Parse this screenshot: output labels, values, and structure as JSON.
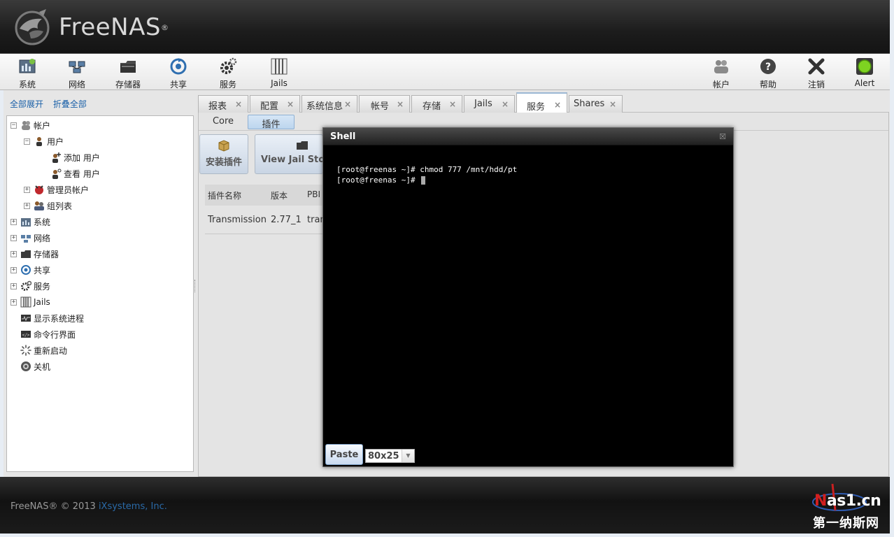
{
  "app": {
    "brand": "FreeNAS",
    "reg": "®"
  },
  "toolbar": {
    "left": [
      {
        "label": "系统",
        "icon": "system-icon"
      },
      {
        "label": "网络",
        "icon": "network-icon"
      },
      {
        "label": "存储器",
        "icon": "storage-icon"
      },
      {
        "label": "共享",
        "icon": "sharing-icon"
      },
      {
        "label": "服务",
        "icon": "services-icon"
      },
      {
        "label": "Jails",
        "icon": "jails-icon"
      }
    ],
    "right": [
      {
        "label": "帐户",
        "icon": "account-icon"
      },
      {
        "label": "帮助",
        "icon": "help-icon"
      },
      {
        "label": "注销",
        "icon": "logout-icon"
      },
      {
        "label": "Alert",
        "icon": "alert-icon"
      }
    ]
  },
  "sidebar": {
    "expand_all": "全部展开",
    "collapse_all": "折叠全部",
    "tree": [
      {
        "label": "帐户",
        "toggle": "−",
        "icon": "account-icon"
      },
      {
        "label": "用户",
        "toggle": "−",
        "icon": "user-icon"
      },
      {
        "label": "添加 用户",
        "toggle": "",
        "icon": "add-user-icon"
      },
      {
        "label": "查看 用户",
        "toggle": "",
        "icon": "view-user-icon"
      },
      {
        "label": "管理员帐户",
        "toggle": "+",
        "icon": "admin-icon"
      },
      {
        "label": "组列表",
        "toggle": "+",
        "icon": "group-icon"
      },
      {
        "label": "系统",
        "toggle": "+",
        "icon": "system-icon"
      },
      {
        "label": "网络",
        "toggle": "+",
        "icon": "network-icon"
      },
      {
        "label": "存储器",
        "toggle": "+",
        "icon": "storage-icon"
      },
      {
        "label": "共享",
        "toggle": "+",
        "icon": "sharing-icon"
      },
      {
        "label": "服务",
        "toggle": "+",
        "icon": "services-icon"
      },
      {
        "label": "Jails",
        "toggle": "+",
        "icon": "jails-icon"
      },
      {
        "label": "显示系统进程",
        "toggle": "",
        "icon": "process-icon"
      },
      {
        "label": "命令行界面",
        "toggle": "",
        "icon": "shell-icon"
      },
      {
        "label": "重新启动",
        "toggle": "",
        "icon": "reboot-icon"
      },
      {
        "label": "关机",
        "toggle": "",
        "icon": "shutdown-icon"
      }
    ]
  },
  "tabs": [
    {
      "label": "报表",
      "close": "×"
    },
    {
      "label": "配置",
      "close": "×"
    },
    {
      "label": "系统信息",
      "close": "×"
    },
    {
      "label": "帐号",
      "close": "×"
    },
    {
      "label": "存储",
      "close": "×"
    },
    {
      "label": "Jails",
      "close": "×"
    },
    {
      "label": "服务",
      "close": "×",
      "active": true
    },
    {
      "label": "Shares",
      "close": "×"
    }
  ],
  "subtabs": [
    {
      "label": "Core"
    },
    {
      "label": "插件",
      "active": true
    }
  ],
  "plugin_buttons": {
    "install": "安装插件",
    "view_jail_storage": "View Jail Stor"
  },
  "plugin_table": {
    "headers": [
      "插件名称",
      "版本",
      "PBI"
    ],
    "rows": [
      [
        "Transmission",
        "2.77_1",
        "tran"
      ]
    ]
  },
  "shell": {
    "title": "Shell",
    "close": "☒",
    "lines": [
      "[root@freenas ~]# chmod 777 /mnt/hdd/pt",
      "[root@freenas ~]# "
    ],
    "paste_label": "Paste",
    "size_value": "80x25",
    "size_arrow": "▼"
  },
  "footer": {
    "copyright": "FreeNAS® © 2013 ",
    "company": "iXsystems, Inc."
  },
  "watermark": {
    "line1_n": "N",
    "line1_rest": "as1.cn",
    "line2": "第一纳斯网"
  },
  "colors": {
    "link": "#1a60a8",
    "terminal_bg": "#000000",
    "header_bg": "#1c1c1c"
  }
}
